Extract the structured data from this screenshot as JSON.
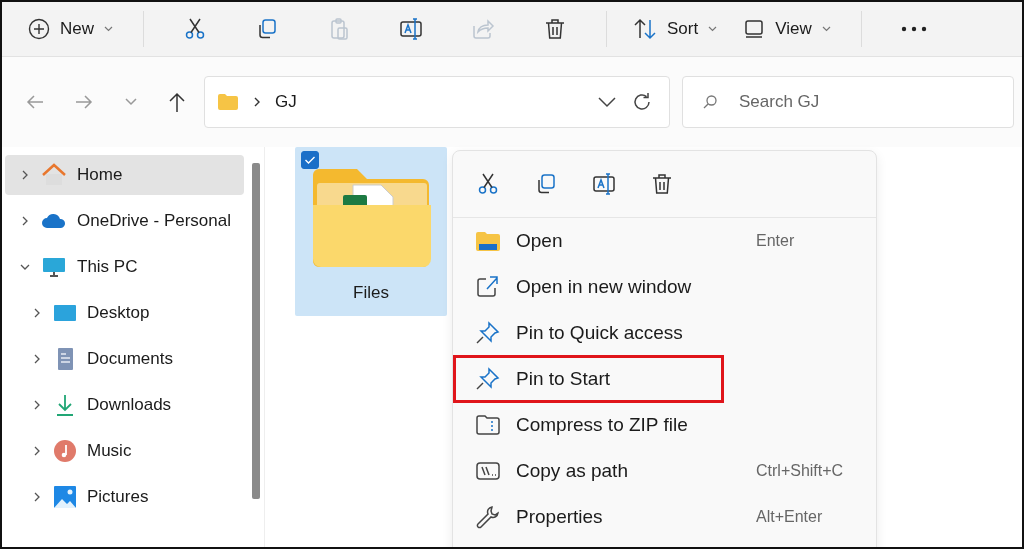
{
  "toolbar": {
    "new_button": {
      "label": "New"
    },
    "icon_buttons": [
      {
        "disabled": false
      },
      {
        "disabled": false
      },
      {
        "disabled": true
      },
      {
        "disabled": false
      },
      {
        "disabled": true
      },
      {
        "disabled": false
      }
    ],
    "sort_button": {
      "label": "Sort"
    },
    "view_button": {
      "label": "View"
    }
  },
  "address_bar": {
    "path": "GJ"
  },
  "search": {
    "placeholder": "Search GJ"
  },
  "sidebar": {
    "items": [
      {
        "label": "Home",
        "selected": true,
        "expanded": false
      },
      {
        "label": "OneDrive - Personal",
        "selected": false,
        "expanded": false
      },
      {
        "label": "This PC",
        "selected": false,
        "expanded": true,
        "children": [
          {
            "label": "Desktop",
            "selected": false,
            "expanded": false
          },
          {
            "label": "Documents",
            "selected": false,
            "expanded": false
          },
          {
            "label": "Downloads",
            "selected": false,
            "expanded": false
          },
          {
            "label": "Music",
            "selected": false,
            "expanded": false
          },
          {
            "label": "Pictures",
            "selected": false,
            "expanded": false
          }
        ]
      }
    ]
  },
  "files": [
    {
      "name": "Files",
      "selected": true,
      "checked": true
    }
  ],
  "context_menu": {
    "items": [
      {
        "label": "Open",
        "shortcut": "Enter",
        "highlighted": false
      },
      {
        "label": "Open in new window",
        "highlighted": false
      },
      {
        "label": "Pin to Quick access",
        "highlighted": false
      },
      {
        "label": "Pin to Start",
        "highlighted": true
      },
      {
        "label": "Compress to ZIP file",
        "highlighted": false
      },
      {
        "label": "Copy as path",
        "shortcut": "Ctrl+Shift+C",
        "highlighted": false
      },
      {
        "label": "Properties",
        "shortcut": "Alt+Enter",
        "highlighted": false
      }
    ]
  }
}
